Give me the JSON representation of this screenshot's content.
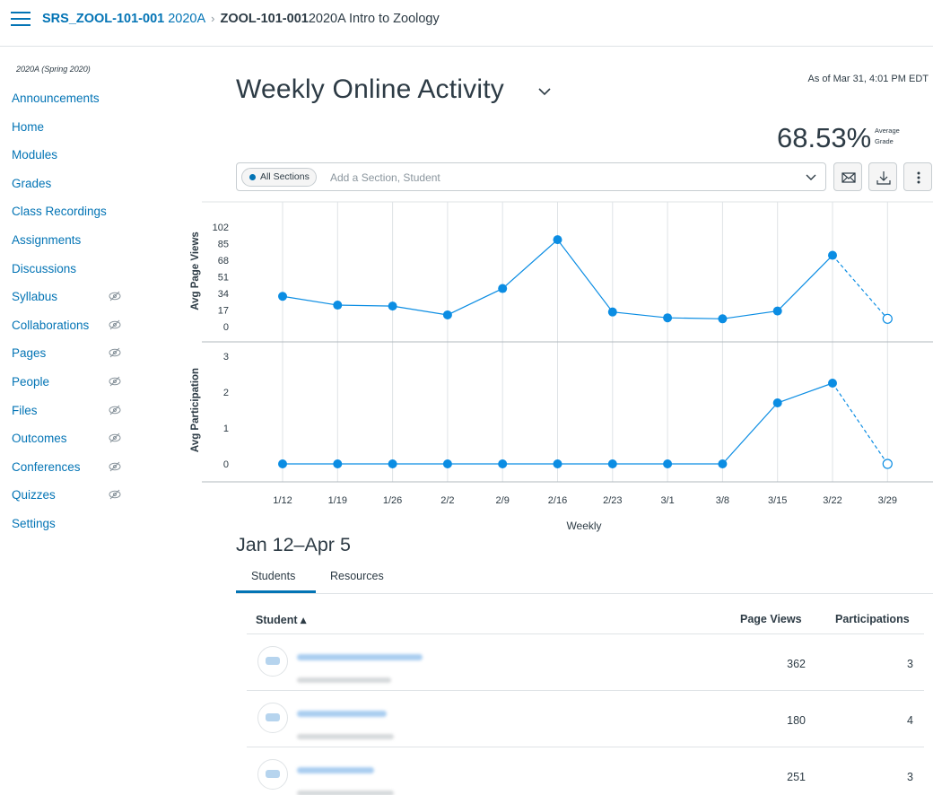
{
  "header": {
    "course_link_bold": "SRS_ZOOL-101-001",
    "course_link_term": " 2020A",
    "separator": "›",
    "current_bold": "ZOOL-101-001",
    "current_rest": "2020A Intro to Zoology"
  },
  "sidebar": {
    "term": "2020A (Spring 2020)",
    "items": [
      {
        "label": "Announcements",
        "hidden_icon": false
      },
      {
        "label": "Home",
        "hidden_icon": false
      },
      {
        "label": "Modules",
        "hidden_icon": false
      },
      {
        "label": "Grades",
        "hidden_icon": false
      },
      {
        "label": "Class Recordings",
        "hidden_icon": false
      },
      {
        "label": "Assignments",
        "hidden_icon": false
      },
      {
        "label": "Discussions",
        "hidden_icon": false
      },
      {
        "label": "Syllabus",
        "hidden_icon": true
      },
      {
        "label": "Collaborations",
        "hidden_icon": true
      },
      {
        "label": "Pages",
        "hidden_icon": true
      },
      {
        "label": "People",
        "hidden_icon": true
      },
      {
        "label": "Files",
        "hidden_icon": true
      },
      {
        "label": "Outcomes",
        "hidden_icon": true
      },
      {
        "label": "Conferences",
        "hidden_icon": true
      },
      {
        "label": "Quizzes",
        "hidden_icon": true
      },
      {
        "label": "Settings",
        "hidden_icon": false
      }
    ]
  },
  "main": {
    "title": "Weekly Online Activity",
    "as_of": "As of Mar 31, 4:01 PM EDT",
    "average_grade": "68.53%",
    "average_grade_label_1": "Average",
    "average_grade_label_2": "Grade",
    "filter": {
      "pill_label": "All Sections",
      "placeholder": "Add a Section, Student"
    },
    "icons": {
      "message": "envelope-icon",
      "download": "download-icon",
      "more": "kebab-icon"
    },
    "date_range": "Jan 12–Apr 5",
    "tabs": [
      "Students",
      "Resources"
    ],
    "table": {
      "headers": {
        "student": "Student ▴",
        "page_views": "Page Views",
        "participations": "Participations"
      },
      "rows": [
        {
          "page_views": "362",
          "participations": "3"
        },
        {
          "page_views": "180",
          "participations": "4"
        },
        {
          "page_views": "251",
          "participations": "3"
        }
      ]
    }
  },
  "colors": {
    "accent": "#0374b5",
    "line": "#0b8de3",
    "text": "#2d3b45",
    "grid": "#c7cdd1"
  },
  "chart_data": [
    {
      "type": "line",
      "ylabel": "Avg Page Views",
      "x": [
        "1/12",
        "1/19",
        "1/26",
        "2/2",
        "2/9",
        "2/16",
        "2/23",
        "3/1",
        "3/8",
        "3/15",
        "3/22",
        "3/29"
      ],
      "y_ticks": [
        0,
        17,
        34,
        51,
        68,
        85,
        102
      ],
      "ylim": [
        0,
        102
      ],
      "values": [
        31,
        22,
        21,
        12,
        39,
        89,
        15,
        9,
        8,
        16,
        73,
        8
      ],
      "last_point_partial": true
    },
    {
      "type": "line",
      "ylabel": "Avg Participation",
      "xlabel": "Weekly",
      "x": [
        "1/12",
        "1/19",
        "1/26",
        "2/2",
        "2/9",
        "2/16",
        "2/23",
        "3/1",
        "3/8",
        "3/15",
        "3/22",
        "3/29"
      ],
      "y_ticks": [
        0,
        1,
        2,
        3
      ],
      "ylim": [
        0,
        3
      ],
      "values": [
        0,
        0,
        0,
        0,
        0,
        0,
        0,
        0,
        0,
        1.7,
        2.25,
        0
      ],
      "last_point_partial": true
    }
  ]
}
